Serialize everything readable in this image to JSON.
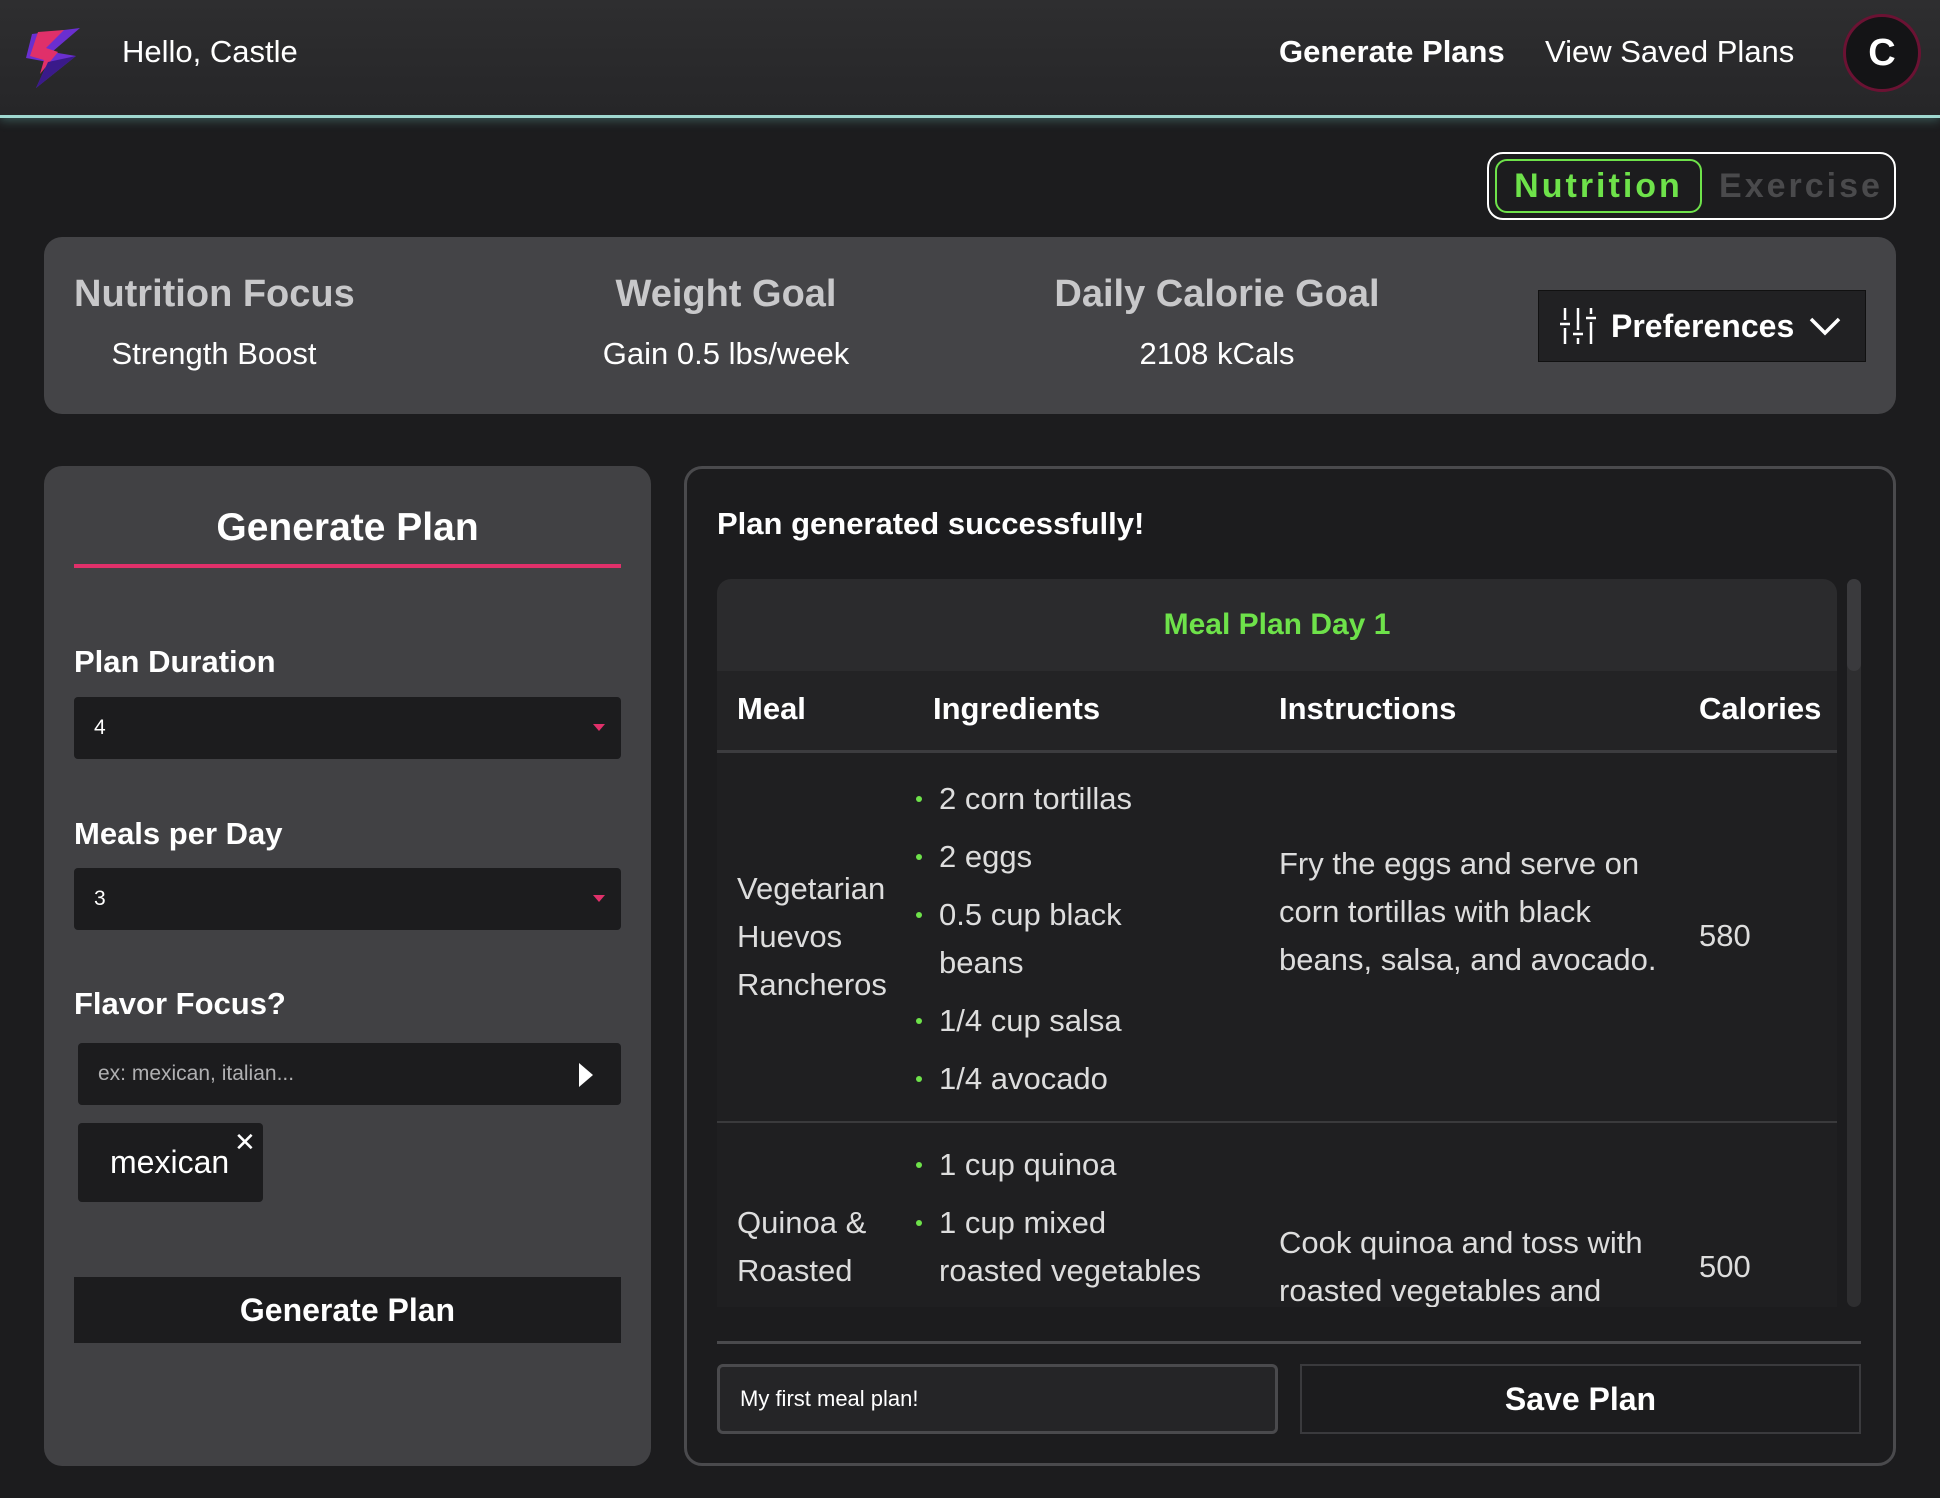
{
  "header": {
    "greeting": "Hello, Castle",
    "nav": {
      "generate": "Generate Plans",
      "saved": "View Saved Plans"
    },
    "avatar_initial": "C",
    "logo_icon": "lightning-s-logo"
  },
  "mode_toggle": {
    "active": "Nutrition",
    "inactive": "Exercise",
    "active_color": "#6ee24a"
  },
  "summary": {
    "focus_label": "Nutrition Focus",
    "focus_value": "Strength Boost",
    "weight_label": "Weight Goal",
    "weight_value": "Gain 0.5 lbs/week",
    "calorie_label": "Daily Calorie Goal",
    "calorie_value": "2108 kCals",
    "preferences_label": "Preferences"
  },
  "generate": {
    "title": "Generate Plan",
    "duration_label": "Plan Duration",
    "duration_value": "4",
    "meals_label": "Meals per Day",
    "meals_value": "3",
    "flavor_label": "Flavor Focus?",
    "flavor_placeholder": "ex: mexican, italian...",
    "tags": [
      "mexican"
    ],
    "button_label": "Generate Plan",
    "accent_color": "#e0306a"
  },
  "result": {
    "message": "Plan generated successfully!",
    "day_title": "Meal Plan Day 1",
    "columns": [
      "Meal",
      "Ingredients",
      "Instructions",
      "Calories"
    ],
    "rows": [
      {
        "meal": "Vegetarian Huevos Rancheros",
        "ingredients": [
          "2 corn tortillas",
          "2 eggs",
          "0.5 cup black beans",
          "1/4 cup salsa",
          "1/4 avocado"
        ],
        "instructions": "Fry the eggs and serve on corn tortillas with black beans, salsa, and avocado.",
        "calories": "580"
      },
      {
        "meal": "Quinoa & Roasted",
        "ingredients": [
          "1 cup quinoa",
          "1 cup mixed roasted vegetables"
        ],
        "instructions": "Cook quinoa and toss with roasted vegetables and",
        "calories": "500"
      }
    ],
    "plan_name_value": "My first meal plan!",
    "save_label": "Save Plan"
  }
}
